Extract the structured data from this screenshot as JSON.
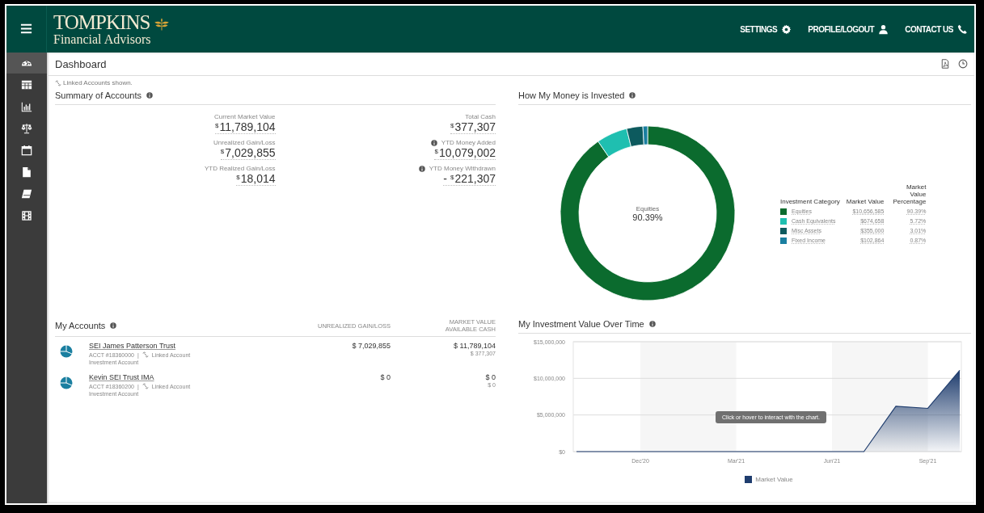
{
  "header": {
    "logo_title": "TOMPKINS",
    "logo_subtitle": "Financial Advisors",
    "nav": [
      {
        "label": "SETTINGS",
        "kind": "gear"
      },
      {
        "label": "PROFILE/LOGOUT",
        "kind": "user"
      },
      {
        "label": "CONTACT US",
        "kind": "phone"
      }
    ]
  },
  "sidebar": {
    "items": [
      {
        "kind": "gauge",
        "selected": true
      },
      {
        "kind": "table",
        "selected": false
      },
      {
        "kind": "bars",
        "selected": false
      },
      {
        "kind": "scales",
        "selected": false
      },
      {
        "kind": "calendar",
        "selected": false
      },
      {
        "kind": "document",
        "selected": false
      },
      {
        "kind": "note",
        "selected": false
      },
      {
        "kind": "film",
        "selected": false
      }
    ]
  },
  "page": {
    "title": "Dashboard"
  },
  "linked_note": "Linked Accounts shown.",
  "summary": {
    "title": "Summary of Accounts",
    "columns": [
      [
        {
          "label": "Current Market Value",
          "currency": "$",
          "value": "11,789,104",
          "info": false
        },
        {
          "label": "Unrealized Gain/Loss",
          "currency": "$",
          "value": "7,029,855",
          "info": false
        },
        {
          "label": "YTD Realized Gain/Loss",
          "currency": "$",
          "value": "18,014",
          "info": false
        }
      ],
      [
        {
          "label": "Total Cash",
          "currency": "$",
          "value": "377,307",
          "info": false
        },
        {
          "label": "YTD Money Added",
          "currency": "$",
          "value": "10,079,002",
          "info": true
        },
        {
          "label": "YTD Money Withdrawn",
          "sign": "-",
          "currency": "$",
          "value": "221,307",
          "info": true
        }
      ]
    ]
  },
  "invested": {
    "title": "How My Money is Invested",
    "center_label": "Equities",
    "center_value": "90.39%",
    "legend_columns": [
      "Investment Category",
      "Market Value"
    ],
    "categories": [
      {
        "color": "#0b6b2e",
        "market_value": "$10,656,585",
        "percentage": "90.39%"
      },
      {
        "color": "#1fbfb0",
        "market_value": "$674,658",
        "percentage": "5.72%"
      },
      {
        "color": "#0d5a5e",
        "market_value": "$355,000",
        "percentage": "3.01%"
      },
      {
        "color": "#1a7fa0",
        "market_value": "$102,864",
        "percentage": "0.87%"
      }
    ],
    "chart_data": {
      "type": "donut",
      "categories": [
        "Equities",
        "Cash Equivalents",
        "Misc Assets",
        "Fixed Income"
      ],
      "series": [
        {
          "name": "Market Value Percentage",
          "values": [
            90.39,
            5.72,
            3.01,
            0.87
          ]
        }
      ]
    }
  },
  "accounts": {
    "title": "My Accounts",
    "col_unrealized": "UNREALIZED GAIN/LOSS",
    "col_market": "MARKET VALUE",
    "col_cash": "AVAILABLE CASH",
    "rows": [
      {
        "name": "SEI James Patterson Trust",
        "acct": "ACCT #18360000",
        "separator": "|",
        "linked": "Linked Account",
        "type": "Investment Account",
        "unrealized": "$ 7,029,855",
        "market_value": "$ 11,789,104",
        "available_cash": "$ 377,307"
      },
      {
        "name": "Kevin SEI Trust IMA",
        "acct": "ACCT #18360200",
        "separator": "|",
        "linked": "Linked Account",
        "type": "Investment Account",
        "unrealized": "$ 0",
        "market_value": "$ 0",
        "available_cash": "$ 0"
      }
    ]
  },
  "over_time": {
    "title": "My Investment Value Over Time",
    "tooltip": "Click or hover to interact with the chart.",
    "chart_data": {
      "type": "area",
      "categories": [
        null,
        null,
        "Dec'20",
        null,
        null,
        "Mar'21",
        null,
        null,
        "Jun'21",
        null,
        null,
        "Sep'21",
        null
      ],
      "series": [
        {
          "name": "Market Value",
          "color": "#1f3d6e",
          "values": [
            0,
            0,
            0,
            0,
            0,
            0,
            0,
            0,
            0,
            0,
            6200000,
            5900000,
            11100000
          ]
        }
      ],
      "ylim": [
        0,
        15000000
      ],
      "yticks": [
        {
          "value": 0,
          "label": "$0"
        },
        {
          "value": 5000000,
          "label": "$5,000,000"
        },
        {
          "value": 10000000,
          "label": "$10,000,000"
        },
        {
          "value": 15000000,
          "label": "$15,000,000"
        }
      ]
    }
  }
}
